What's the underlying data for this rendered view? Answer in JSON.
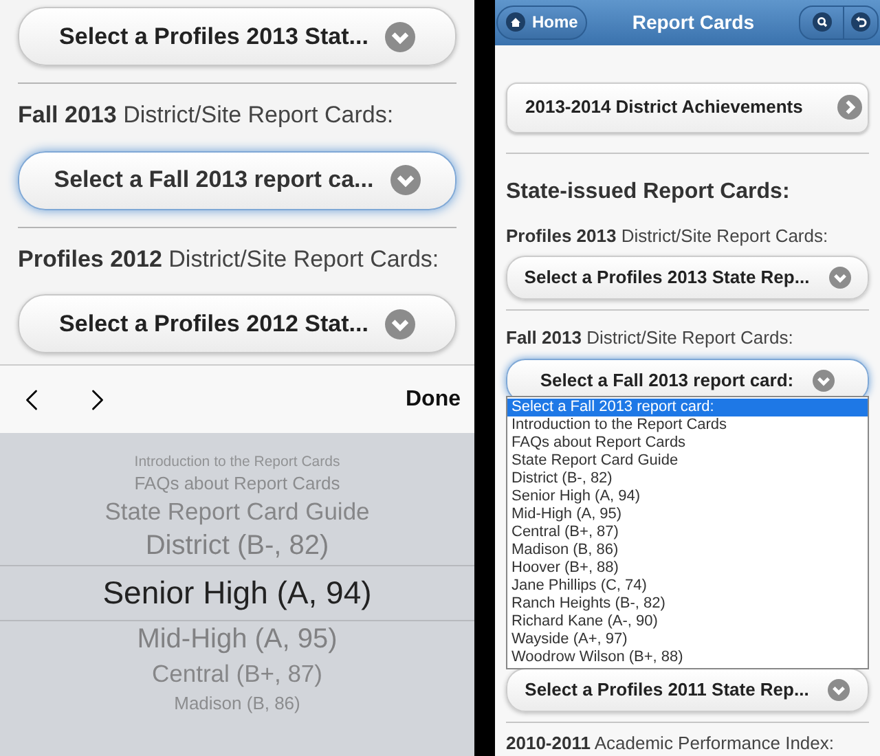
{
  "left_screen": {
    "sections": [
      {
        "select": "Select a Profiles 2013 Stat...",
        "focused": false
      },
      {
        "label_bold": "Fall 2013",
        "label": "District/Site Report Cards:",
        "select": "Select a Fall 2013 report ca...",
        "focused": true
      },
      {
        "label_bold": "Profiles 2012",
        "label": "District/Site Report Cards:",
        "select": "Select a Profiles 2012 Stat...",
        "focused": false
      }
    ],
    "toolbar": {
      "done": "Done"
    },
    "picker": {
      "options": [
        {
          "text": "Introduction to the Report Cards",
          "selected": false
        },
        {
          "text": "FAQs about Report Cards",
          "selected": false
        },
        {
          "text": "State Report Card Guide",
          "selected": false
        },
        {
          "text": "District (B-, 82)",
          "selected": false
        },
        {
          "text": "Senior High (A, 94)",
          "selected": true
        },
        {
          "text": "Mid-High (A, 95)",
          "selected": false
        },
        {
          "text": "Central (B+, 87)",
          "selected": false
        },
        {
          "text": "Madison (B, 86)",
          "selected": false
        }
      ]
    }
  },
  "right_screen": {
    "header": {
      "home": "Home",
      "title": "Report Cards"
    },
    "link_button": "2013-2014 District Achievements",
    "heading": "State-issued Report Cards:",
    "sections": [
      {
        "label_bold": "Profiles 2013",
        "label": "District/Site Report Cards:",
        "select": "Select a Profiles 2013 State Rep...",
        "focused": false,
        "expanded": false
      },
      {
        "label_bold": "Fall 2013",
        "label": "District/Site Report Cards:",
        "select": "Select a Fall 2013 report card:",
        "focused": true,
        "expanded": true,
        "options": [
          {
            "text": "Select a Fall 2013 report card:",
            "selected": true
          },
          {
            "text": "Introduction to the Report Cards",
            "selected": false
          },
          {
            "text": "FAQs about Report Cards",
            "selected": false
          },
          {
            "text": "State Report Card Guide",
            "selected": false
          },
          {
            "text": "District (B-, 82)",
            "selected": false
          },
          {
            "text": "Senior High (A, 94)",
            "selected": false
          },
          {
            "text": "Mid-High (A, 95)",
            "selected": false
          },
          {
            "text": "Central (B+, 87)",
            "selected": false
          },
          {
            "text": "Madison (B, 86)",
            "selected": false
          },
          {
            "text": "Hoover (B+, 88)",
            "selected": false
          },
          {
            "text": "Jane Phillips (C, 74)",
            "selected": false
          },
          {
            "text": "Ranch Heights (B-, 82)",
            "selected": false
          },
          {
            "text": "Richard Kane (A-, 90)",
            "selected": false
          },
          {
            "text": "Wayside (A+, 97)",
            "selected": false
          },
          {
            "text": "Woodrow Wilson (B+, 88)",
            "selected": false
          }
        ]
      },
      {
        "select": "Select a Profiles 2011 State Rep...",
        "focused": false,
        "expanded": false
      }
    ],
    "footer_label": {
      "label_bold": "2010-2011",
      "label": "Academic Performance Index:"
    }
  }
}
